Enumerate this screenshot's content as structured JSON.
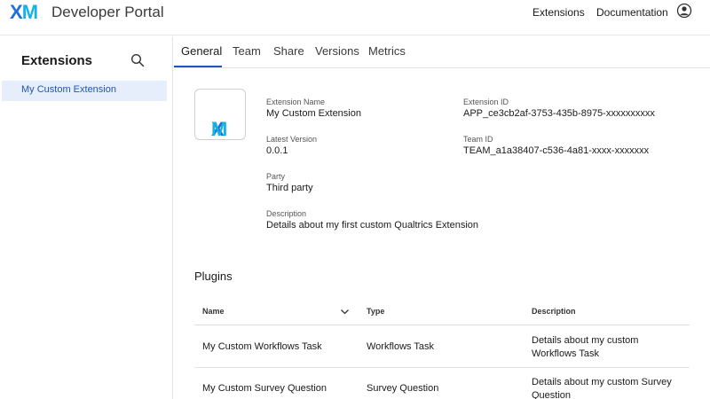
{
  "header": {
    "logo_x": "X",
    "logo_m": "M",
    "title": "Developer Portal",
    "nav": [
      "Extensions",
      "Documentation"
    ],
    "user_icon": "user-circle-icon"
  },
  "sidebar": {
    "title": "Extensions",
    "search_icon": "search-icon",
    "items": [
      {
        "label": "My Custom Extension",
        "selected": true
      }
    ]
  },
  "tabs": [
    {
      "label": "General",
      "active": true
    },
    {
      "label": "Team"
    },
    {
      "label": "Share"
    },
    {
      "label": "Versions"
    },
    {
      "label": "Metrics"
    }
  ],
  "extension": {
    "logo_x": "X",
    "logo_m": "M",
    "name_label": "Extension Name",
    "name": "My Custom Extension",
    "id_label": "Extension ID",
    "id": "APP_ce3cb2af-3753-435b-8975-xxxxxxxxxx",
    "version_label": "Latest Version",
    "version": "0.0.1",
    "team_label": "Team ID",
    "team": "TEAM_a1a38407-c536-4a81-xxxx-xxxxxxx",
    "party_label": "Party",
    "party": "Third party",
    "description_label": "Description",
    "description": "Details about my first custom Qualtrics Extension"
  },
  "plugins": {
    "title": "Plugins",
    "columns": [
      "Name",
      "Type",
      "Description"
    ],
    "rows": [
      {
        "name": "My Custom Workflows Task",
        "type": "Workflows Task",
        "description": "Details about my custom Workflows Task"
      },
      {
        "name": "My Custom Survey Question",
        "type": "Survey Question",
        "description": "Details about my custom Survey Question"
      }
    ]
  },
  "colors": {
    "accent": "#1f56b8",
    "selected_bg": "#e6eefb",
    "logo_blue": "#1f6fdc",
    "logo_cyan": "#15b2e5"
  }
}
